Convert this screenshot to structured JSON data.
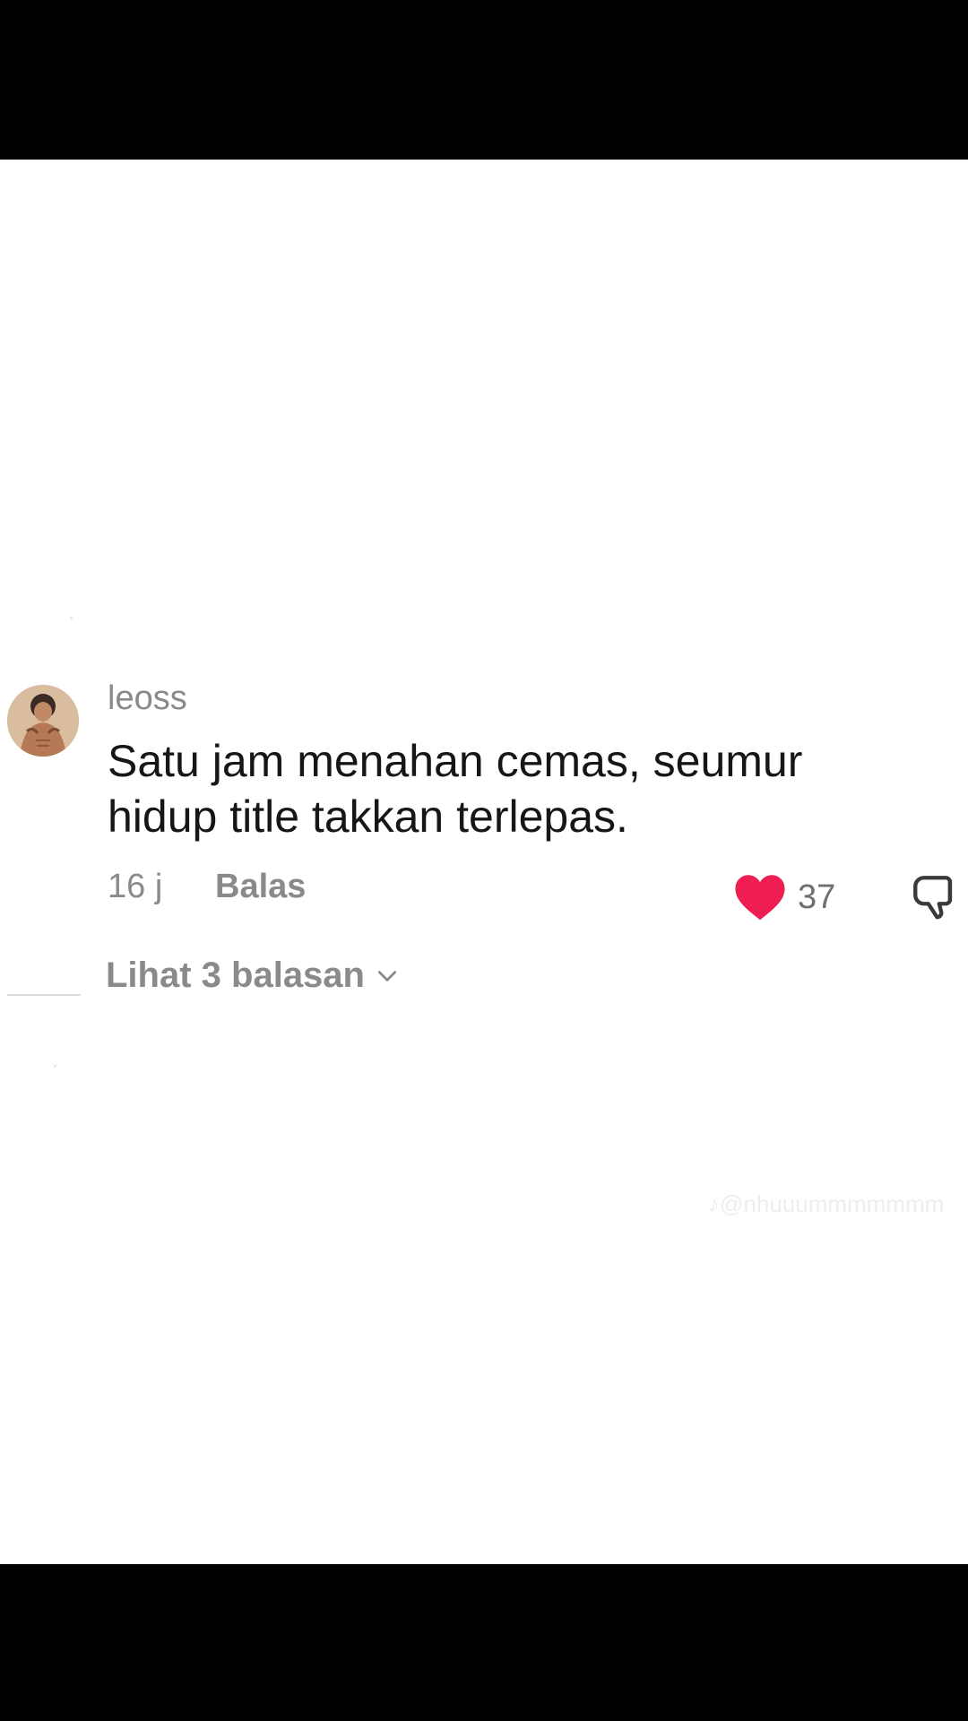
{
  "comment": {
    "username": "leoss",
    "text": "Satu jam menahan cemas, seumur hidup title takkan terlepas.",
    "time": "16 j",
    "reply_label": "Balas",
    "like_count": "37",
    "view_replies_label": "Lihat 3 balasan",
    "liked": true
  },
  "watermark": "♪@nhuuummmmmmm",
  "colors": {
    "like_red": "#ee1d52",
    "muted_text": "#8a8a8a",
    "body_text": "#161616"
  },
  "icons": {
    "like": "heart-icon",
    "dislike": "thumbs-down-icon",
    "expand": "chevron-down-icon"
  }
}
